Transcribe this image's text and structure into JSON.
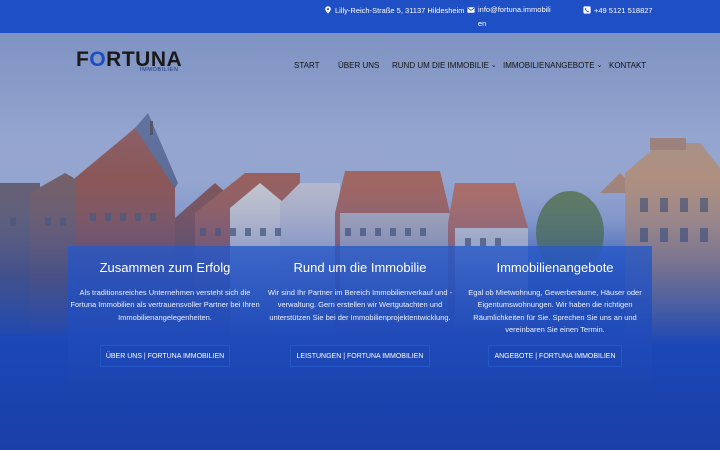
{
  "topbar": {
    "address": "Lilly-Reich-Straße 5, 31137 Hildesheim",
    "email": "info@fortuna.immobilien",
    "phone": "+49 5121 518827",
    "icons": [
      "map-pin-icon",
      "envelope-icon",
      "phone-icon"
    ]
  },
  "logo": {
    "name_part1": "F",
    "name_o": "O",
    "name_part2": "RTUNA",
    "subtitle": "IMMOBILIEN"
  },
  "nav": {
    "items": [
      {
        "label": "START"
      },
      {
        "label": "ÜBER UNS"
      },
      {
        "label": "RUND UM DIE IMMOBILIE",
        "dropdown": true
      },
      {
        "label": "IMMOBILIENANGEBOTE",
        "dropdown": true
      },
      {
        "label": "KONTAKT"
      }
    ]
  },
  "columns": [
    {
      "title": "Zusammen zum Erfolg",
      "text": "Als traditionsreiches Unternehmen versteht sich die Fortuna Immobilien als vertrauensvoller Partner bei Ihren Immobilienangelegenheiten.",
      "button": "ÜBER UNS | FORTUNA IMMOBILIEN"
    },
    {
      "title": "Rund um die Immobilie",
      "text": "Wir sind Ihr Partner im Bereich Immobilienverkauf und -verwaltung. Gern erstellen wir Wertgutachten und unterstützen Sie bei der Immobilienprojektentwicklung.",
      "button": "LEISTUNGEN | FORTUNA IMMOBILIEN"
    },
    {
      "title": "Immobilienangebote",
      "text": "Egal ob Mietwohnung, Gewerberäume, Häuser oder Eigentumswohnungen. Wir haben die richtigen Räumlichkeiten für Sie. Sprechen Sie uns an und vereinbaren Sie einen Termin.",
      "button": "ANGEBOTE | FORTUNA IMMOBILIEN"
    }
  ],
  "colors": {
    "brand_blue": "#1f4fc4",
    "panel_blue": "#2658c8",
    "button_blue": "#1c47b5"
  }
}
